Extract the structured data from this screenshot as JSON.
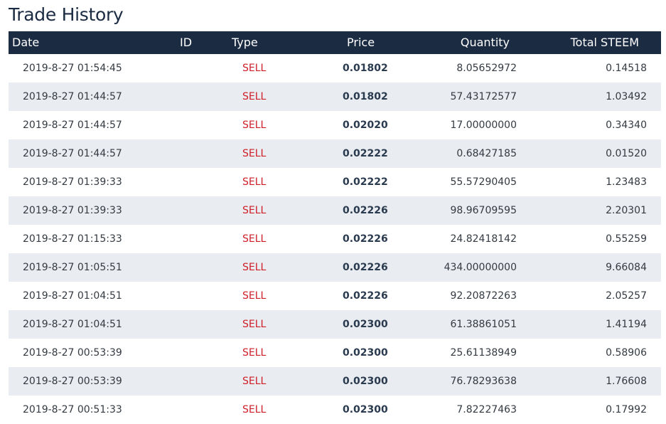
{
  "page": {
    "title": "Trade History"
  },
  "table": {
    "columns": [
      "Date",
      "ID",
      "Type",
      "Price",
      "Quantity",
      "Total STEEM"
    ],
    "rows": [
      {
        "date": "2019-8-27 01:54:45",
        "type": "SELL",
        "price": "0.01802",
        "quantity": "8.05652972",
        "total": "0.14518"
      },
      {
        "date": "2019-8-27 01:44:57",
        "type": "SELL",
        "price": "0.01802",
        "quantity": "57.43172577",
        "total": "1.03492"
      },
      {
        "date": "2019-8-27 01:44:57",
        "type": "SELL",
        "price": "0.02020",
        "quantity": "17.00000000",
        "total": "0.34340"
      },
      {
        "date": "2019-8-27 01:44:57",
        "type": "SELL",
        "price": "0.02222",
        "quantity": "0.68427185",
        "total": "0.01520"
      },
      {
        "date": "2019-8-27 01:39:33",
        "type": "SELL",
        "price": "0.02222",
        "quantity": "55.57290405",
        "total": "1.23483"
      },
      {
        "date": "2019-8-27 01:39:33",
        "type": "SELL",
        "price": "0.02226",
        "quantity": "98.96709595",
        "total": "2.20301"
      },
      {
        "date": "2019-8-27 01:15:33",
        "type": "SELL",
        "price": "0.02226",
        "quantity": "24.82418142",
        "total": "0.55259"
      },
      {
        "date": "2019-8-27 01:05:51",
        "type": "SELL",
        "price": "0.02226",
        "quantity": "434.00000000",
        "total": "9.66084"
      },
      {
        "date": "2019-8-27 01:04:51",
        "type": "SELL",
        "price": "0.02226",
        "quantity": "92.20872263",
        "total": "2.05257"
      },
      {
        "date": "2019-8-27 01:04:51",
        "type": "SELL",
        "price": "0.02300",
        "quantity": "61.38861051",
        "total": "1.41194"
      },
      {
        "date": "2019-8-27 00:53:39",
        "type": "SELL",
        "price": "0.02300",
        "quantity": "25.61138949",
        "total": "0.58906"
      },
      {
        "date": "2019-8-27 00:53:39",
        "type": "SELL",
        "price": "0.02300",
        "quantity": "76.78293638",
        "total": "1.76608"
      },
      {
        "date": "2019-8-27 00:51:33",
        "type": "SELL",
        "price": "0.02300",
        "quantity": "7.82227463",
        "total": "0.17992"
      }
    ]
  },
  "colors": {
    "header_bg": "#1b2b42",
    "sell": "#d01d2a",
    "stripe": "#e9ecf0"
  }
}
